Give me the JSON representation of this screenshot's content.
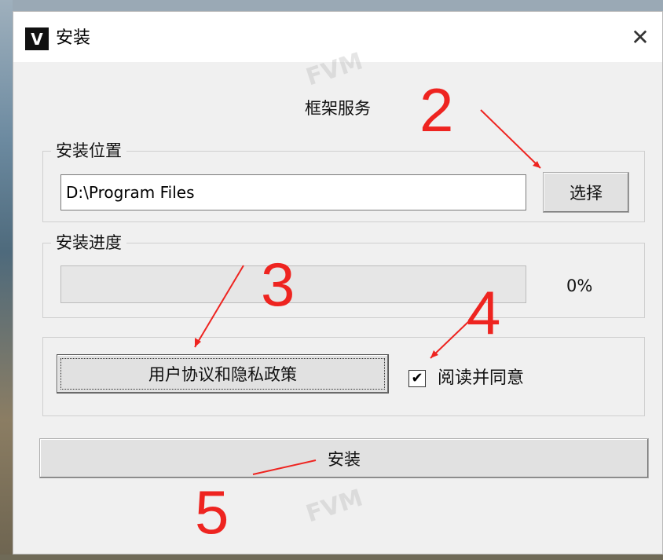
{
  "window": {
    "title": "安装",
    "app_icon_letter": "V",
    "close_symbol": "✕"
  },
  "header": {
    "framework_text": "框架服务"
  },
  "install_location": {
    "group_label": "安装位置",
    "path_value": "D:\\Program Files",
    "choose_button_label": "选择"
  },
  "install_progress": {
    "group_label": "安装进度",
    "percent_text": "0%",
    "progress": 0
  },
  "agreement": {
    "agreement_button_label": "用户协议和隐私政策",
    "checkbox_checked": true,
    "checkbox_symbol": "✔",
    "checkbox_label": "阅读并同意"
  },
  "actions": {
    "install_button_label": "安装"
  },
  "watermark": {
    "text": "FVM"
  },
  "annotations": {
    "numbers": [
      "2",
      "3",
      "4",
      "5"
    ],
    "color": "#ee2420"
  },
  "colors": {
    "window_bg": "#f0f0f0",
    "button_bg": "#e1e1e1",
    "progress_green": "#06b025"
  }
}
